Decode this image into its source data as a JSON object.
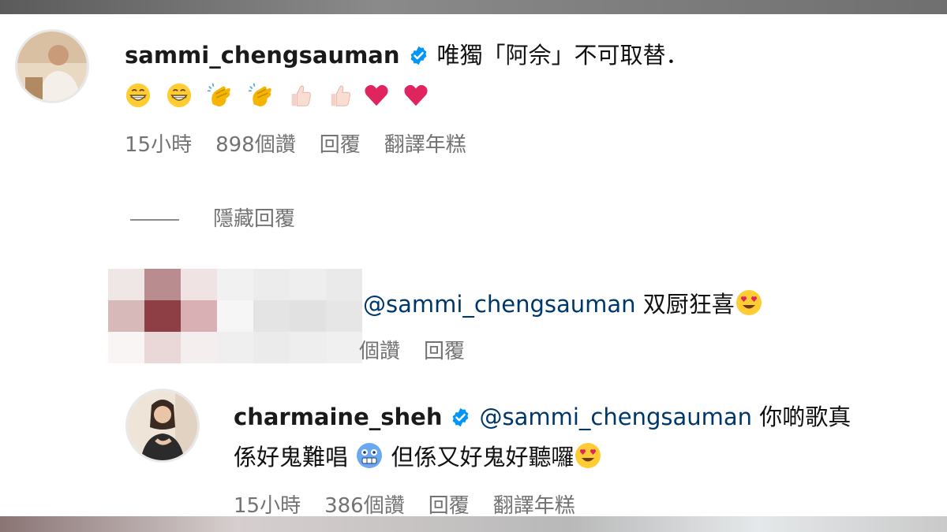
{
  "comment1": {
    "username": "sammi_chengsauman",
    "text": "唯獨「阿佘」不可取替．",
    "emojis": [
      "grin-emoji",
      "grin-emoji",
      "clap-emoji",
      "clap-emoji",
      "thumbs-up-emoji",
      "thumbs-up-emoji",
      "red-heart-emoji",
      "red-heart-emoji"
    ],
    "time": "15小時",
    "likes": "898個讚",
    "reply": "回覆",
    "translate": "翻譯年糕"
  },
  "hide_replies": "隱藏回覆",
  "reply1": {
    "mention": "@sammi_chengsauman",
    "text": "双厨狂喜",
    "likes_partial": "個讚",
    "reply": "回覆"
  },
  "reply2": {
    "username": "charmaine_sheh",
    "mention": "@sammi_chengsauman",
    "text_line1": "你啲歌真",
    "text_line2a": "係好鬼難唱",
    "text_line2b": "但係又好鬼好聽囉",
    "time": "15小時",
    "likes": "386個讚",
    "reply": "回覆",
    "translate": "翻譯年糕"
  },
  "colors": {
    "verified": "#0095f6",
    "mention": "#00376b",
    "meta": "#737373",
    "heart": "#e0245e"
  }
}
